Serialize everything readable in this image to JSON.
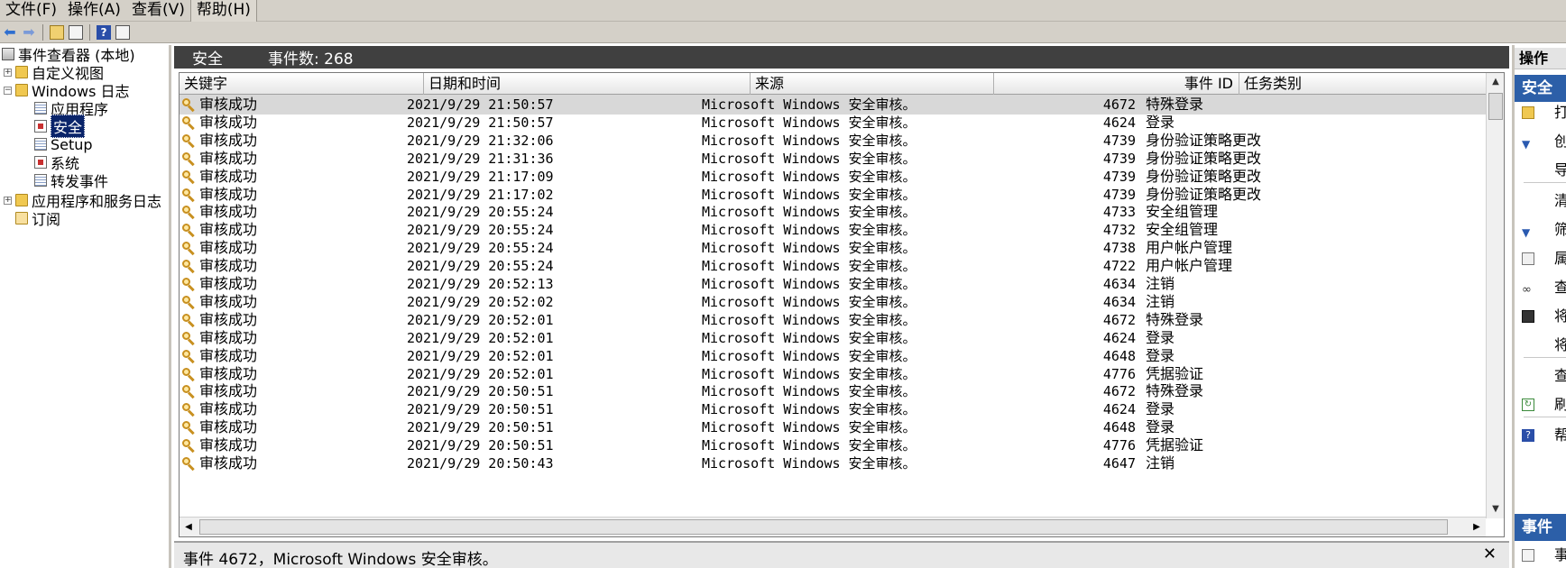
{
  "menubar": {
    "items": [
      "文件(F)",
      "操作(A)",
      "查看(V)",
      "帮助(H)"
    ]
  },
  "toolbar": {
    "icons": [
      "back-arrow-icon",
      "forward-arrow-icon",
      "up-folder-icon",
      "show-hide-tree-icon",
      "help-icon",
      "show-hide-action-pane-icon"
    ]
  },
  "tree": {
    "root": "事件查看器 (本地)",
    "custom_views": "自定义视图",
    "windows_logs": "Windows 日志",
    "app_log": "应用程序",
    "security_log": "安全",
    "setup_log": "Setup",
    "system_log": "系统",
    "forwarded_log": "转发事件",
    "app_services": "应用程序和服务日志",
    "subscriptions": "订阅"
  },
  "header": {
    "title": "安全",
    "count_label": "事件数: 268"
  },
  "columns": {
    "keyword": "关键字",
    "datetime": "日期和时间",
    "source": "来源",
    "event_id": "事件 ID",
    "task": "任务类别"
  },
  "rows": [
    {
      "keyword": "审核成功",
      "datetime": "2021/9/29 21:50:57",
      "source": "Microsoft Windows 安全审核。",
      "event_id": "4672",
      "task": "特殊登录"
    },
    {
      "keyword": "审核成功",
      "datetime": "2021/9/29 21:50:57",
      "source": "Microsoft Windows 安全审核。",
      "event_id": "4624",
      "task": "登录"
    },
    {
      "keyword": "审核成功",
      "datetime": "2021/9/29 21:32:06",
      "source": "Microsoft Windows 安全审核。",
      "event_id": "4739",
      "task": "身份验证策略更改"
    },
    {
      "keyword": "审核成功",
      "datetime": "2021/9/29 21:31:36",
      "source": "Microsoft Windows 安全审核。",
      "event_id": "4739",
      "task": "身份验证策略更改"
    },
    {
      "keyword": "审核成功",
      "datetime": "2021/9/29 21:17:09",
      "source": "Microsoft Windows 安全审核。",
      "event_id": "4739",
      "task": "身份验证策略更改"
    },
    {
      "keyword": "审核成功",
      "datetime": "2021/9/29 21:17:02",
      "source": "Microsoft Windows 安全审核。",
      "event_id": "4739",
      "task": "身份验证策略更改"
    },
    {
      "keyword": "审核成功",
      "datetime": "2021/9/29 20:55:24",
      "source": "Microsoft Windows 安全审核。",
      "event_id": "4733",
      "task": "安全组管理"
    },
    {
      "keyword": "审核成功",
      "datetime": "2021/9/29 20:55:24",
      "source": "Microsoft Windows 安全审核。",
      "event_id": "4732",
      "task": "安全组管理"
    },
    {
      "keyword": "审核成功",
      "datetime": "2021/9/29 20:55:24",
      "source": "Microsoft Windows 安全审核。",
      "event_id": "4738",
      "task": "用户帐户管理"
    },
    {
      "keyword": "审核成功",
      "datetime": "2021/9/29 20:55:24",
      "source": "Microsoft Windows 安全审核。",
      "event_id": "4722",
      "task": "用户帐户管理"
    },
    {
      "keyword": "审核成功",
      "datetime": "2021/9/29 20:52:13",
      "source": "Microsoft Windows 安全审核。",
      "event_id": "4634",
      "task": "注销"
    },
    {
      "keyword": "审核成功",
      "datetime": "2021/9/29 20:52:02",
      "source": "Microsoft Windows 安全审核。",
      "event_id": "4634",
      "task": "注销"
    },
    {
      "keyword": "审核成功",
      "datetime": "2021/9/29 20:52:01",
      "source": "Microsoft Windows 安全审核。",
      "event_id": "4672",
      "task": "特殊登录"
    },
    {
      "keyword": "审核成功",
      "datetime": "2021/9/29 20:52:01",
      "source": "Microsoft Windows 安全审核。",
      "event_id": "4624",
      "task": "登录"
    },
    {
      "keyword": "审核成功",
      "datetime": "2021/9/29 20:52:01",
      "source": "Microsoft Windows 安全审核。",
      "event_id": "4648",
      "task": "登录"
    },
    {
      "keyword": "审核成功",
      "datetime": "2021/9/29 20:52:01",
      "source": "Microsoft Windows 安全审核。",
      "event_id": "4776",
      "task": "凭据验证"
    },
    {
      "keyword": "审核成功",
      "datetime": "2021/9/29 20:50:51",
      "source": "Microsoft Windows 安全审核。",
      "event_id": "4672",
      "task": "特殊登录"
    },
    {
      "keyword": "审核成功",
      "datetime": "2021/9/29 20:50:51",
      "source": "Microsoft Windows 安全审核。",
      "event_id": "4624",
      "task": "登录"
    },
    {
      "keyword": "审核成功",
      "datetime": "2021/9/29 20:50:51",
      "source": "Microsoft Windows 安全审核。",
      "event_id": "4648",
      "task": "登录"
    },
    {
      "keyword": "审核成功",
      "datetime": "2021/9/29 20:50:51",
      "source": "Microsoft Windows 安全审核。",
      "event_id": "4776",
      "task": "凭据验证"
    },
    {
      "keyword": "审核成功",
      "datetime": "2021/9/29 20:50:43",
      "source": "Microsoft Windows 安全审核。",
      "event_id": "4647",
      "task": "注销"
    }
  ],
  "detail": {
    "text": "事件 4672，Microsoft Windows 安全审核。",
    "close": "✕"
  },
  "actions": {
    "header": "操作",
    "section_security": "安全",
    "section_event": "事件",
    "items": [
      {
        "icon": "open-folder-icon",
        "label": "打"
      },
      {
        "icon": "filter-icon",
        "label": "创"
      },
      {
        "icon": "",
        "label": "导"
      },
      {
        "icon": "",
        "label": "清"
      },
      {
        "icon": "filter-icon",
        "label": "筛"
      },
      {
        "icon": "properties-icon",
        "label": "属"
      },
      {
        "icon": "find-icon",
        "label": "查"
      },
      {
        "icon": "save-icon",
        "label": "将"
      },
      {
        "icon": "",
        "label": "将"
      },
      {
        "icon": "",
        "label": "查"
      },
      {
        "icon": "refresh-icon",
        "label": "刷"
      },
      {
        "icon": "help-icon",
        "label": "帮"
      }
    ],
    "event_item": "事"
  },
  "colors": {
    "header_bg": "#404040",
    "selection": "#0a246a",
    "action_section": "#2c5fa8",
    "chrome": "#d4d0c8"
  }
}
